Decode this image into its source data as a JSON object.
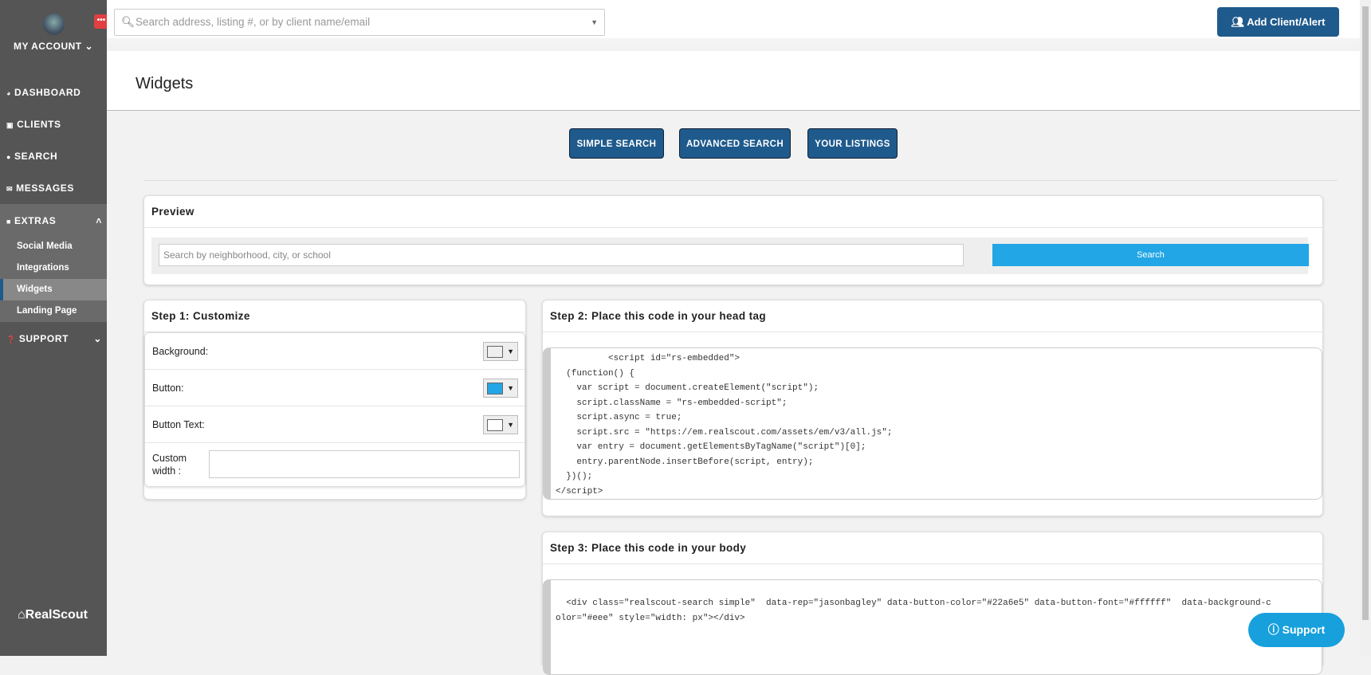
{
  "sidebar": {
    "account": "MY ACCOUNT",
    "notif": "•••",
    "items": [
      {
        "label": "DASHBOARD"
      },
      {
        "label": "CLIENTS"
      },
      {
        "label": "SEARCH"
      },
      {
        "label": "MESSAGES"
      },
      {
        "label": "EXTRAS"
      },
      {
        "label": "SUPPORT"
      }
    ],
    "sub": [
      {
        "label": "Social Media"
      },
      {
        "label": "Integrations"
      },
      {
        "label": "Widgets"
      },
      {
        "label": "Landing Page"
      }
    ],
    "logo": "RealScout"
  },
  "top": {
    "search_placeholder": "Search address, listing #, or by client name/email",
    "add_button": "Add Client/Alert"
  },
  "page": {
    "title": "Widgets",
    "tabs": [
      "SIMPLE SEARCH",
      "ADVANCED SEARCH",
      "YOUR LISTINGS"
    ]
  },
  "preview": {
    "title": "Preview",
    "placeholder": "Search by neighborhood, city, or school",
    "button": "Search"
  },
  "step1": {
    "title": "Step 1: Customize",
    "background": "Background:",
    "button": "Button:",
    "button_text": "Button Text:",
    "width": "Custom width :",
    "colors": {
      "background": "#eeeeee",
      "button": "#22a6e5",
      "button_text": "#ffffff"
    }
  },
  "step2": {
    "title": "Step 2: Place this code in your head tag",
    "code": "          <script id=\"rs-embedded\">\n  (function() {\n    var script = document.createElement(\"script\");\n    script.className = \"rs-embedded-script\";\n    script.async = true;\n    script.src = \"https://em.realscout.com/assets/em/v3/all.js\";\n    var entry = document.getElementsByTagName(\"script\")[0];\n    entry.parentNode.insertBefore(script, entry);\n  })();\n</script>"
  },
  "step3": {
    "title": "Step 3: Place this code in your body",
    "code": "  <div class=\"realscout-search simple\"  data-rep=\"jasonbagley\" data-button-color=\"#22a6e5\" data-button-font=\"#ffffff\"  data-background-c\nolor=\"#eee\" style=\"width: px\"></div>"
  },
  "support": "Support"
}
